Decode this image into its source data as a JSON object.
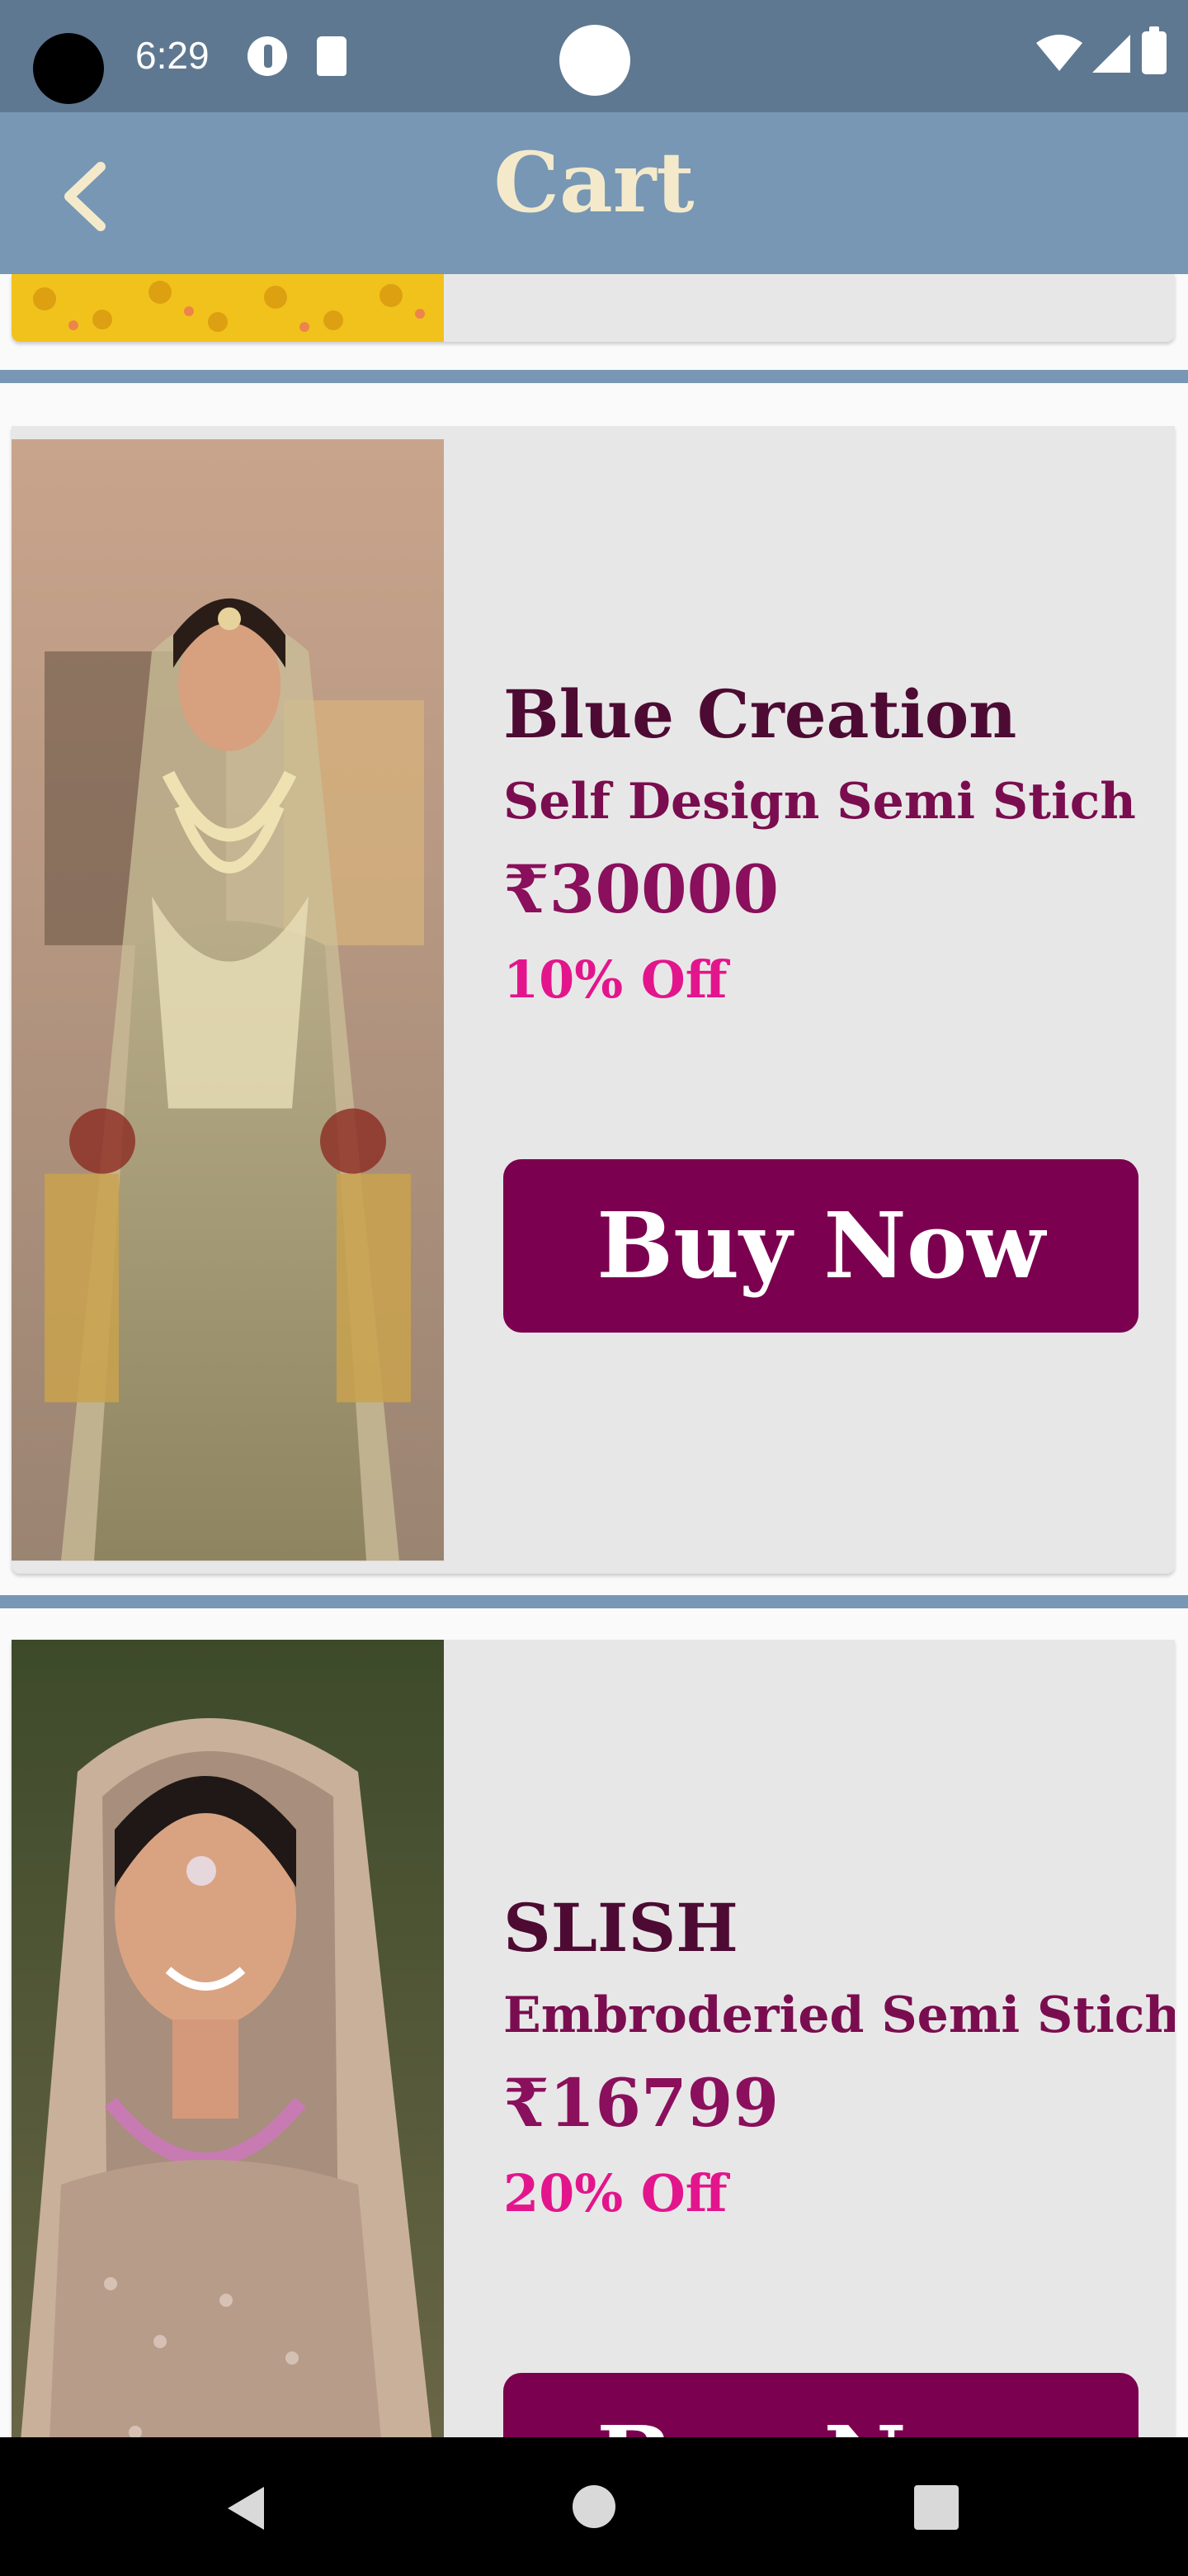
{
  "status_bar": {
    "time": "6:29"
  },
  "app_bar": {
    "title": "Cart",
    "back_icon": "chevron-left-icon"
  },
  "items": [
    {
      "brand": "",
      "description": "",
      "price": "",
      "discount": "",
      "buy_label": ""
    },
    {
      "brand": "Blue Creation",
      "description": "Self Design Semi Stich",
      "price": "₹30000",
      "discount": "10%  Off",
      "buy_label": "Buy Now"
    },
    {
      "brand": "SLISH",
      "description": "Embroderied Semi Stich",
      "price": "₹16799",
      "discount": "20%  Off",
      "buy_label": "Buy Now"
    }
  ],
  "nav_bar": {
    "icons": [
      "back-triangle-icon",
      "home-circle-icon",
      "recents-square-icon"
    ]
  },
  "colors": {
    "status_bar": "#5f7891",
    "app_bar": "#7797b4",
    "title": "#f4eacb",
    "brand": "#4d0b33",
    "price": "#8a0f5c",
    "discount": "#e3158c",
    "buy_button": "#7b0050"
  }
}
